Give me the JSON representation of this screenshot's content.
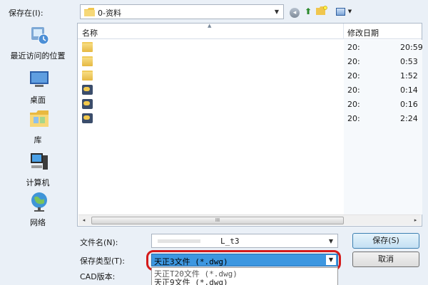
{
  "toolbar": {
    "save_in_label": "保存在(I):",
    "location": "0-资料",
    "back_glyph": "◂",
    "up_glyph": "⬆",
    "combo_arrow": "▼",
    "views_arrow": "▼"
  },
  "places": [
    {
      "label": "最近访问的位置",
      "icon": "recent-places-icon"
    },
    {
      "label": "桌面",
      "icon": "desktop-icon"
    },
    {
      "label": "库",
      "icon": "library-icon"
    },
    {
      "label": "计算机",
      "icon": "computer-icon"
    },
    {
      "label": "网络",
      "icon": "network-icon"
    }
  ],
  "file_list": {
    "columns": {
      "name": "名称",
      "date": "修改日期"
    },
    "sort_glyph": "▲",
    "rows": [
      {
        "type": "folder",
        "date": "20:",
        "time": "20:59"
      },
      {
        "type": "folder",
        "date": "20:",
        "time": "0:53"
      },
      {
        "type": "folder",
        "date": "20:",
        "time": "1:52"
      },
      {
        "type": "dwg",
        "date": "20:",
        "time": "0:14"
      },
      {
        "type": "dwg",
        "date": "20:",
        "time": "0:16"
      },
      {
        "type": "dwg",
        "date": "20:",
        "time": "2:24"
      }
    ],
    "scroll_left": "◂",
    "scroll_right": "▸",
    "scroll_grip": "III"
  },
  "form": {
    "filename_label": "文件名(N):",
    "filename_value": "L_t3",
    "type_label": "保存类型(T):",
    "type_value": "天正3文件 (*.dwg)",
    "cad_label": "CAD版本:",
    "dropdown_options": [
      "天正T20文件 (*.dwg)",
      "天正9文件 (*.dwg)"
    ],
    "arrow": "▼"
  },
  "buttons": {
    "save": "保存(S)",
    "cancel": "取消"
  },
  "colors": {
    "highlight_ring": "#d41b1b",
    "selected_type_bg": "#3d97e0"
  }
}
